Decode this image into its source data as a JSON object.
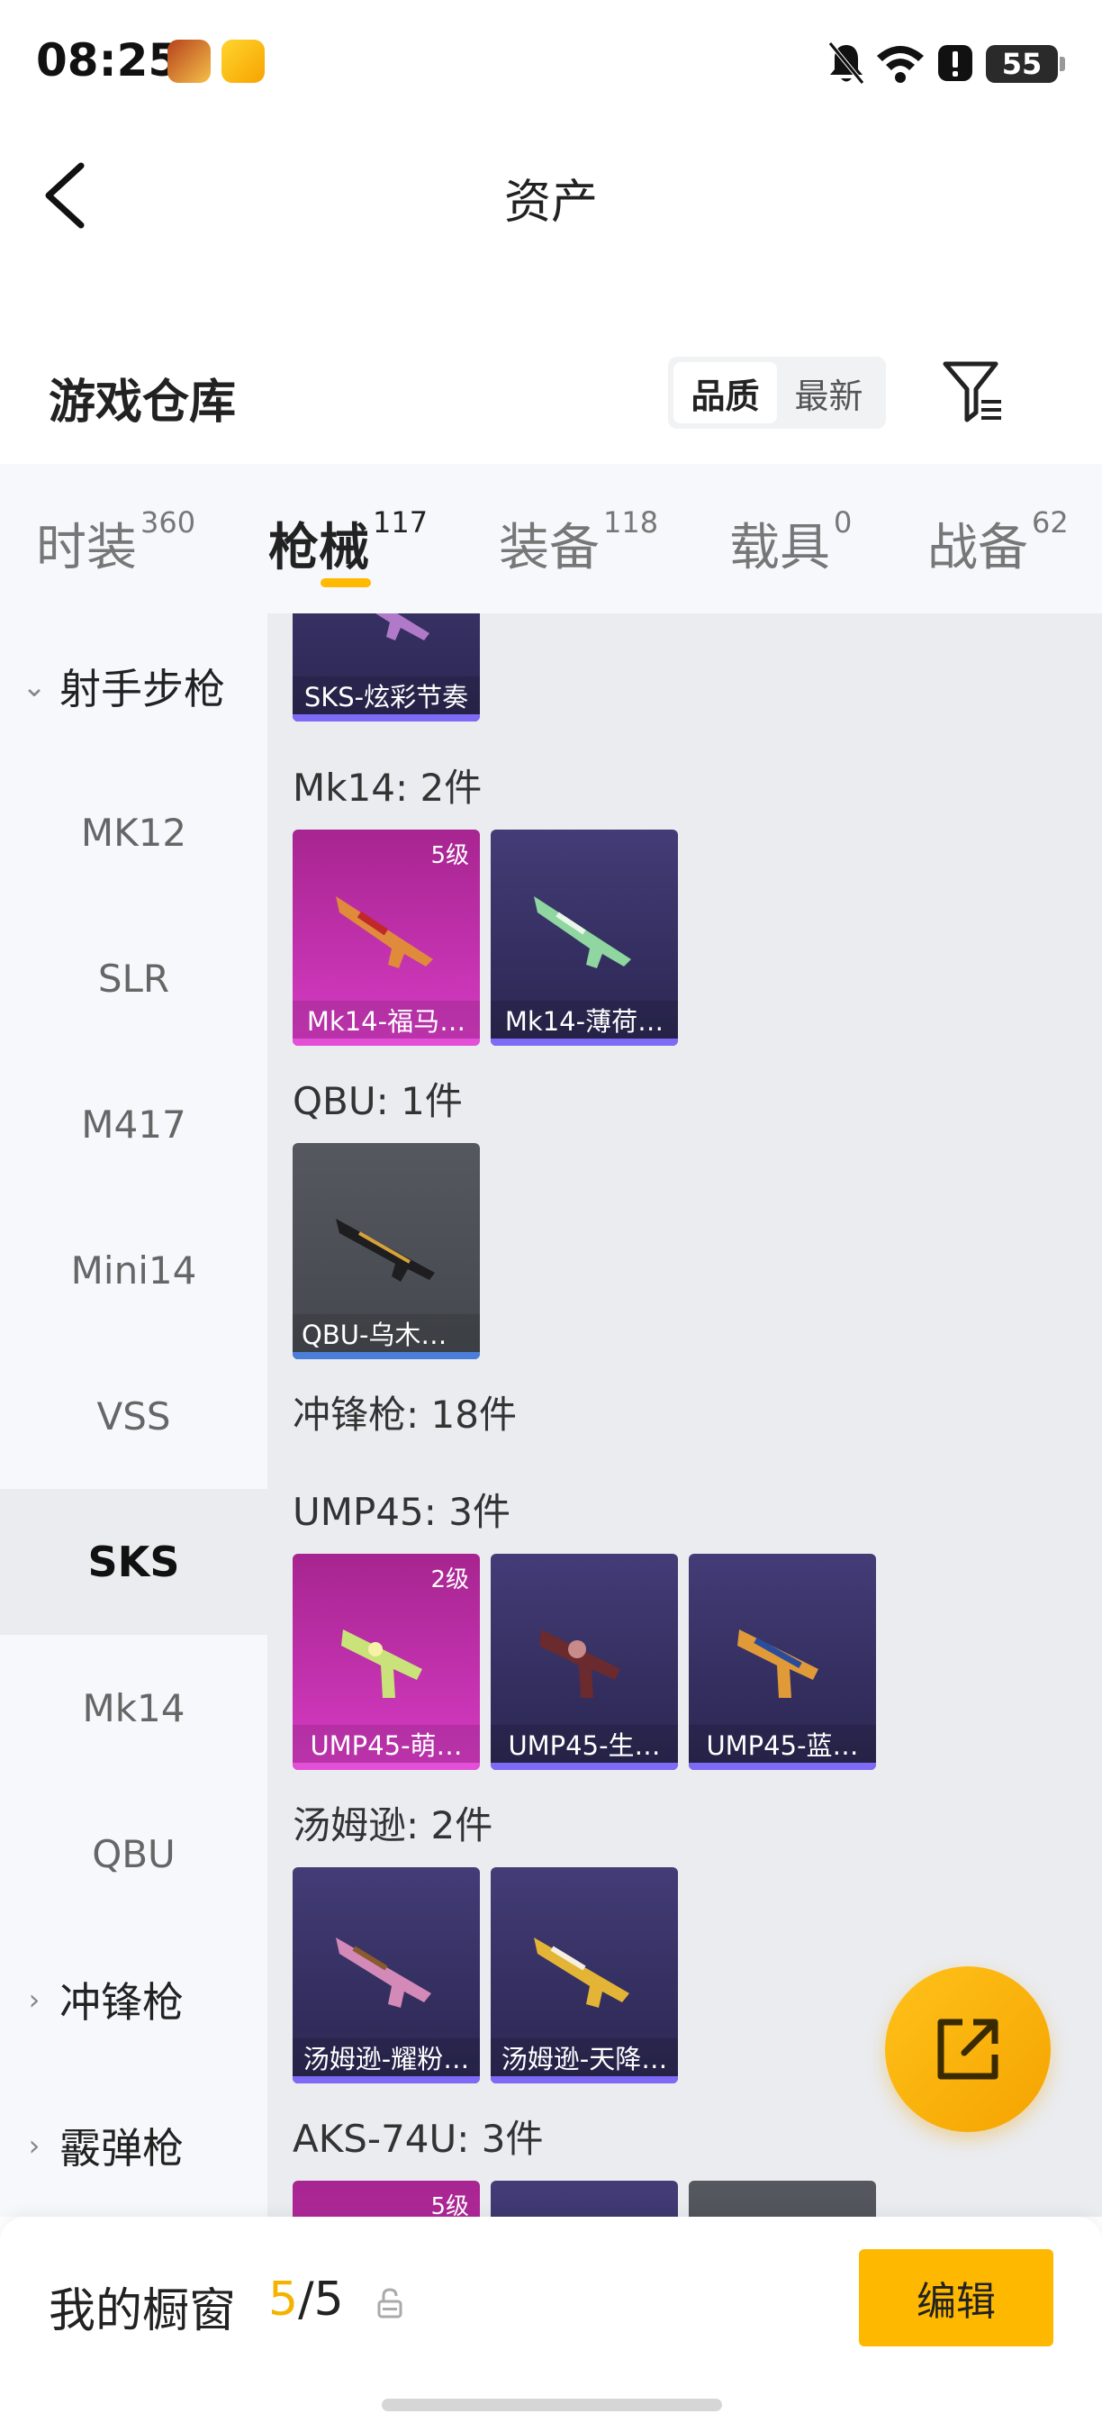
{
  "status_bar": {
    "time": "08:25",
    "battery": "55",
    "icons": [
      "game-app-icon",
      "promo-app-icon",
      "bell-muted-icon",
      "wifi-icon",
      "alert-icon",
      "battery-icon"
    ]
  },
  "header": {
    "title": "资产"
  },
  "warehouse": {
    "title": "游戏仓库",
    "sort_options": [
      "品质",
      "最新"
    ],
    "selected_sort": "品质"
  },
  "tabs": [
    {
      "label": "时装",
      "count": "360"
    },
    {
      "label": "枪械",
      "count": "117"
    },
    {
      "label": "装备",
      "count": "118"
    },
    {
      "label": "载具",
      "count": "0"
    },
    {
      "label": "战备",
      "count": "62"
    }
  ],
  "active_tab": "枪械",
  "sidebar": {
    "group_expanded": "射手步枪",
    "items": [
      "MK12",
      "SLR",
      "M417",
      "Mini14",
      "VSS",
      "SKS",
      "Mk14",
      "QBU"
    ],
    "selected": "SKS",
    "collapsed_groups": [
      "冲锋枪",
      "霰弹枪"
    ]
  },
  "content": {
    "top_partial_card": "SKS-炫彩节奏",
    "sections": [
      {
        "heading": "Mk14: 2件",
        "cards": [
          {
            "name": "Mk14-福马…",
            "level": "5级",
            "rarity": "pink"
          },
          {
            "name": "Mk14-薄荷…",
            "level": "",
            "rarity": "purple"
          }
        ]
      },
      {
        "heading": "QBU: 1件",
        "cards": [
          {
            "name": "QBU-乌木金纹",
            "level": "",
            "rarity": "grey"
          }
        ]
      },
      {
        "heading": "冲锋枪: 18件",
        "cards": []
      },
      {
        "heading": "UMP45: 3件",
        "cards": [
          {
            "name": "UMP45-萌…",
            "level": "2级",
            "rarity": "pink"
          },
          {
            "name": "UMP45-生…",
            "level": "",
            "rarity": "purple"
          },
          {
            "name": "UMP45-蓝…",
            "level": "",
            "rarity": "purple"
          }
        ]
      },
      {
        "heading": "汤姆逊: 2件",
        "cards": [
          {
            "name": "汤姆逊-耀粉…",
            "level": "",
            "rarity": "purple"
          },
          {
            "name": "汤姆逊-天降…",
            "level": "",
            "rarity": "purple"
          }
        ]
      },
      {
        "heading": "AKS-74U: 3件",
        "partial_levels": [
          "5级"
        ]
      }
    ]
  },
  "bottom_bar": {
    "label": "我的橱窗",
    "current": "5",
    "total": "/5",
    "edit_label": "编辑"
  },
  "colors": {
    "accent": "#ffb800",
    "purple_card": "#433c77",
    "pink_card": "#c232b0",
    "grey_card": "#4e5157"
  }
}
